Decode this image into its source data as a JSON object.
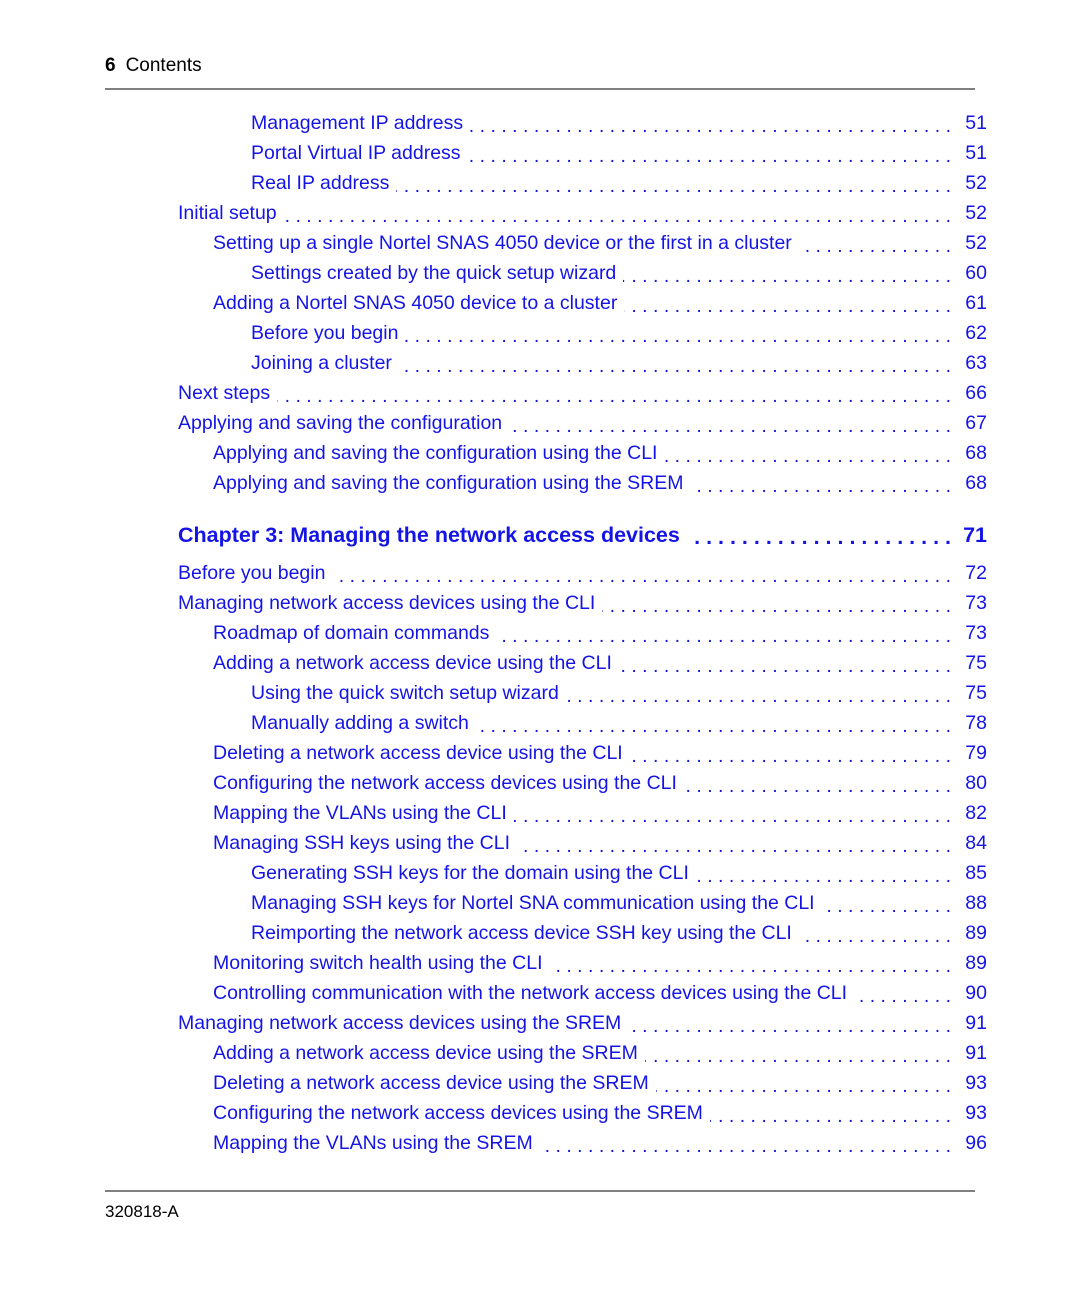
{
  "header": {
    "folio": "6",
    "title": "Contents"
  },
  "footer": {
    "doc_number": "320818-A"
  },
  "colors": {
    "link_blue": "#1414e6",
    "rule_gray": "#7f7f7f",
    "text_black": "#000000"
  },
  "toc": {
    "entries": [
      {
        "level": 3,
        "title": "Management IP address",
        "page": "51",
        "bold": false
      },
      {
        "level": 3,
        "title": "Portal Virtual IP address",
        "page": "51",
        "bold": false
      },
      {
        "level": 3,
        "title": "Real IP address",
        "page": "52",
        "bold": false
      },
      {
        "level": 1,
        "title": "Initial setup",
        "page": "52",
        "bold": false
      },
      {
        "level": 2,
        "title": "Setting up a single Nortel SNAS 4050 device or the first in a cluster",
        "page": "52",
        "bold": false
      },
      {
        "level": 3,
        "title": "Settings created by the quick setup wizard",
        "page": "60",
        "bold": false
      },
      {
        "level": 2,
        "title": "Adding a Nortel SNAS 4050 device to a cluster",
        "page": "61",
        "bold": false
      },
      {
        "level": 3,
        "title": "Before you begin",
        "page": "62",
        "bold": false
      },
      {
        "level": 3,
        "title": "Joining a cluster",
        "page": "63",
        "bold": false
      },
      {
        "level": 1,
        "title": "Next steps",
        "page": "66",
        "bold": false
      },
      {
        "level": 1,
        "title": "Applying and saving the configuration",
        "page": "67",
        "bold": false
      },
      {
        "level": 2,
        "title": "Applying and saving the configuration using the CLI",
        "page": "68",
        "bold": false
      },
      {
        "level": 2,
        "title": "Applying and saving the configuration using the SREM",
        "page": "68",
        "bold": false
      },
      {
        "level": 1,
        "title": "Chapter 3: Managing the network access devices",
        "page": "71",
        "bold": true
      },
      {
        "level": 1,
        "title": "Before you begin",
        "page": "72",
        "bold": false
      },
      {
        "level": 1,
        "title": "Managing network access devices using the CLI",
        "page": "73",
        "bold": false
      },
      {
        "level": 2,
        "title": "Roadmap of domain commands",
        "page": "73",
        "bold": false
      },
      {
        "level": 2,
        "title": "Adding a network access device using the CLI",
        "page": "75",
        "bold": false
      },
      {
        "level": 3,
        "title": "Using the quick switch setup wizard",
        "page": "75",
        "bold": false
      },
      {
        "level": 3,
        "title": "Manually adding a switch",
        "page": "78",
        "bold": false
      },
      {
        "level": 2,
        "title": "Deleting a network access device using the CLI",
        "page": "79",
        "bold": false
      },
      {
        "level": 2,
        "title": "Configuring the network access devices using the CLI",
        "page": "80",
        "bold": false
      },
      {
        "level": 2,
        "title": "Mapping the VLANs using the CLI",
        "page": "82",
        "bold": false
      },
      {
        "level": 2,
        "title": "Managing SSH keys using the CLI",
        "page": "84",
        "bold": false
      },
      {
        "level": 3,
        "title": "Generating SSH keys for the domain using the CLI",
        "page": "85",
        "bold": false
      },
      {
        "level": 3,
        "title": "Managing SSH keys for Nortel SNA communication using the CLI",
        "page": "88",
        "bold": false
      },
      {
        "level": 3,
        "title": "Reimporting the network access device SSH key using the CLI",
        "page": "89",
        "bold": false
      },
      {
        "level": 2,
        "title": "Monitoring switch health using the CLI",
        "page": "89",
        "bold": false
      },
      {
        "level": 2,
        "title": "Controlling communication with the network access devices using the CLI",
        "page": "90",
        "bold": false
      },
      {
        "level": 1,
        "title": "Managing network access devices using the SREM",
        "page": "91",
        "bold": false
      },
      {
        "level": 2,
        "title": "Adding a network access device using the SREM",
        "page": "91",
        "bold": false
      },
      {
        "level": 2,
        "title": "Deleting a network access device using the SREM",
        "page": "93",
        "bold": false
      },
      {
        "level": 2,
        "title": "Configuring the network access devices using the SREM",
        "page": "93",
        "bold": false
      },
      {
        "level": 2,
        "title": "Mapping the VLANs using the SREM",
        "page": "96",
        "bold": false
      }
    ]
  }
}
